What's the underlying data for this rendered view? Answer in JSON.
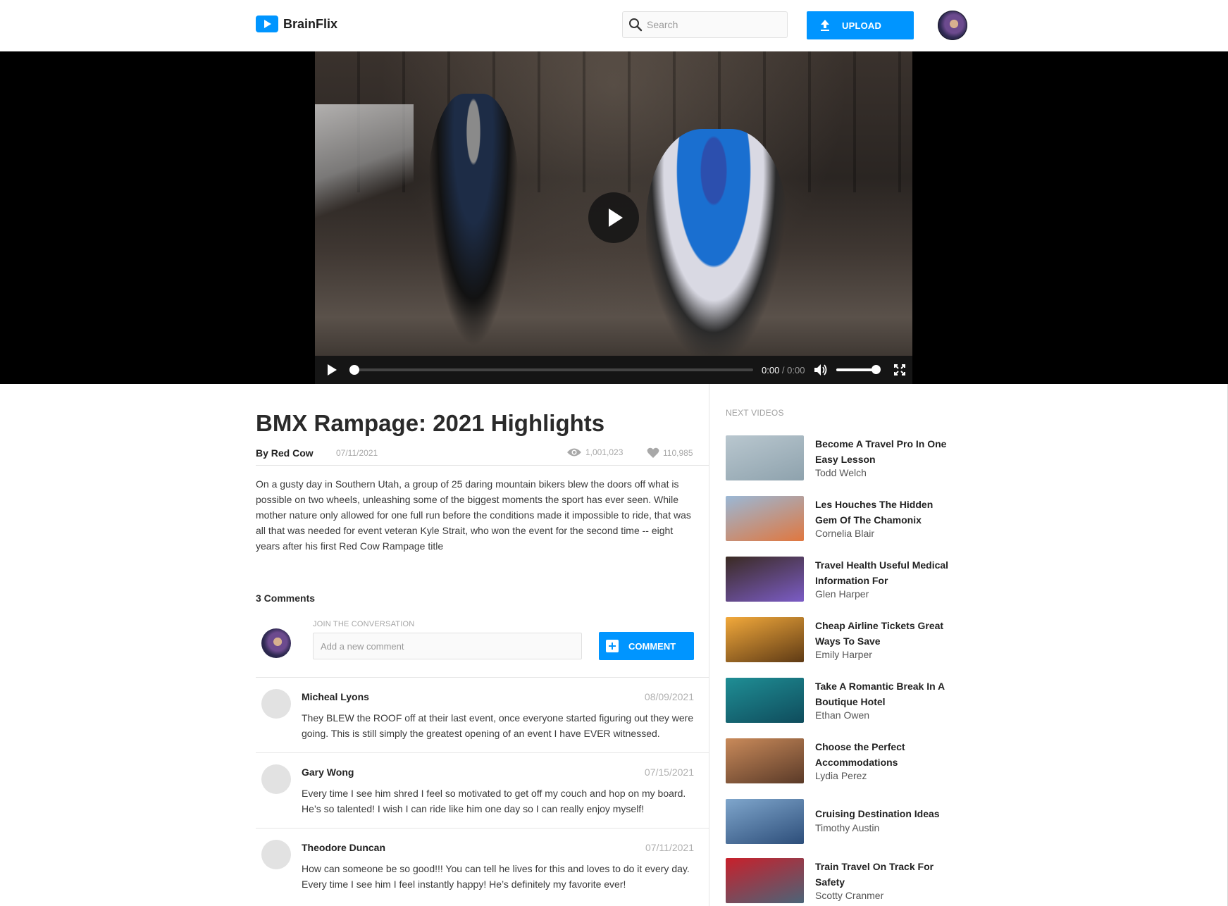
{
  "app": {
    "name": "BrainFlix",
    "search_placeholder": "Search",
    "upload_label": "UPLOAD"
  },
  "player": {
    "time_current": "0:00",
    "time_separator": " / ",
    "time_duration": "0:00",
    "progress": 0.0,
    "volume": 1.0
  },
  "video": {
    "title": "BMX Rampage: 2021 Highlights",
    "author": "By Red Cow",
    "date": "07/11/2021",
    "views": "1,001,023",
    "likes": "110,985",
    "description": "On a gusty day in Southern Utah, a group of 25 daring mountain bikers blew the doors off what is possible on two wheels, unleashing some of the biggest moments the sport has ever seen. While mother nature only allowed for one full run before the conditions made it impossible to ride, that was all that was needed for event veteran Kyle Strait, who won the event for the second time -- eight years after his first Red Cow Rampage title"
  },
  "comments_section": {
    "count_label": "3 Comments",
    "join_label": "JOIN THE CONVERSATION",
    "input_placeholder": "Add a new comment",
    "button_label": "COMMENT",
    "comments": [
      {
        "name": "Micheal Lyons",
        "date": "08/09/2021",
        "text": "They BLEW the ROOF off at their last event, once everyone started figuring out they were going. This is still simply the greatest opening of an event I have EVER witnessed."
      },
      {
        "name": "Gary Wong",
        "date": "07/15/2021",
        "text": "Every time I see him shred I feel so motivated to get off my couch and hop on my board. He’s so talented! I wish I can ride like him one day so I can really enjoy myself!"
      },
      {
        "name": "Theodore Duncan",
        "date": "07/11/2021",
        "text": "How can someone be so good!!! You can tell he lives for this and loves to do it every day. Every time I see him I feel instantly happy! He’s definitely my favorite ever!"
      }
    ]
  },
  "next_videos": {
    "heading": "NEXT VIDEOS",
    "items": [
      {
        "title": "Become A Travel Pro In One Easy Lesson",
        "author": "Todd Welch",
        "colors": [
          "#b9c7cf",
          "#8ea2ad"
        ]
      },
      {
        "title": "Les Houches The Hidden Gem Of The Chamonix",
        "author": "Cornelia Blair",
        "colors": [
          "#9ab8d6",
          "#e0773f"
        ]
      },
      {
        "title": "Travel Health Useful Medical Information For",
        "author": "Glen Harper",
        "colors": [
          "#3a2a22",
          "#7b5cc6"
        ]
      },
      {
        "title": "Cheap Airline Tickets Great Ways To Save",
        "author": "Emily Harper",
        "colors": [
          "#f2a93b",
          "#5e3a15"
        ]
      },
      {
        "title": "Take A Romantic Break In A Boutique Hotel",
        "author": "Ethan Owen",
        "colors": [
          "#1f8e95",
          "#0f4c5c"
        ]
      },
      {
        "title": "Choose the Perfect Accommodations",
        "author": "Lydia Perez",
        "colors": [
          "#c98a5a",
          "#5a3a28"
        ]
      },
      {
        "title": "Cruising Destination Ideas",
        "author": "Timothy Austin",
        "colors": [
          "#7fa6cc",
          "#2d4e7a"
        ]
      },
      {
        "title": "Train Travel On Track For Safety",
        "author": "Scotty Cranmer",
        "colors": [
          "#c8202b",
          "#4b6478"
        ]
      }
    ]
  },
  "colors": {
    "accent": "#0095ff"
  }
}
